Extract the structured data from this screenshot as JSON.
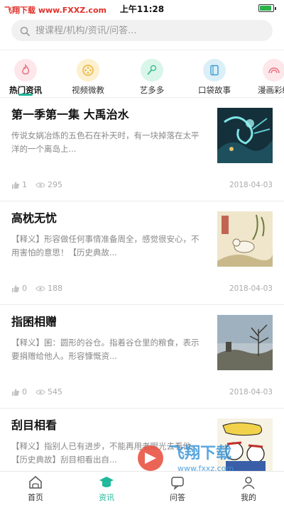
{
  "status_bar": {
    "watermark": "飞翔下载 www.FXXZ.com",
    "time": "上午11:28",
    "battery_level": 0.85
  },
  "search": {
    "placeholder": "搜课程/机构/资讯/问答..."
  },
  "categories": [
    {
      "label": "热门资讯",
      "icon": "fire-icon",
      "color": "#fde7ea",
      "active": true
    },
    {
      "label": "视频微教",
      "icon": "video-icon",
      "color": "#fdf0cf"
    },
    {
      "label": "艺多多",
      "icon": "microphone-icon",
      "color": "#daf5ea"
    },
    {
      "label": "口袋故事",
      "icon": "book-icon",
      "color": "#dbeff8"
    },
    {
      "label": "漫画彩绘",
      "icon": "rainbow-icon",
      "color": "#fde7ea"
    }
  ],
  "articles": [
    {
      "title": "第一季第一集 大禹治水",
      "summary": "传说女娲冶炼的五色石在补天时，有一块掉落在太平洋的一个离岛上...",
      "likes": "1",
      "views": "295",
      "date": "2018-04-03",
      "thumb": "dragon-water-illustration"
    },
    {
      "title": "高枕无忧",
      "summary": "【释义】形容做任何事情准备周全，感觉很安心，不用害怕的意思！【历史典故...",
      "likes": "0",
      "views": "188",
      "date": "2018-04-03",
      "thumb": "chinese-painting-rabbit"
    },
    {
      "title": "指囷相赠",
      "summary": "【释义】囷：圆形的谷仓。指着谷仓里的粮食，表示要捐赠给他人。形容慷慨资...",
      "likes": "0",
      "views": "545",
      "date": "2018-04-03",
      "thumb": "landscape-tree-photo"
    },
    {
      "title": "刮目相看",
      "summary": "【释义】指别人已有进步，不能再用老眼光去看他。【历史典故】刮目相看出自...",
      "likes": "",
      "views": "",
      "date": "",
      "thumb": "comic-illustration"
    }
  ],
  "tabs": [
    {
      "label": "首页",
      "icon": "home-icon"
    },
    {
      "label": "资讯",
      "icon": "graduation-cap-icon",
      "active": true
    },
    {
      "label": "问答",
      "icon": "question-icon"
    },
    {
      "label": "我的",
      "icon": "user-icon"
    }
  ],
  "overlay_watermark": "飞翔下载 www.fxxz.com",
  "colors": {
    "accent": "#1fb89a",
    "watermark_red": "#e0302a"
  }
}
